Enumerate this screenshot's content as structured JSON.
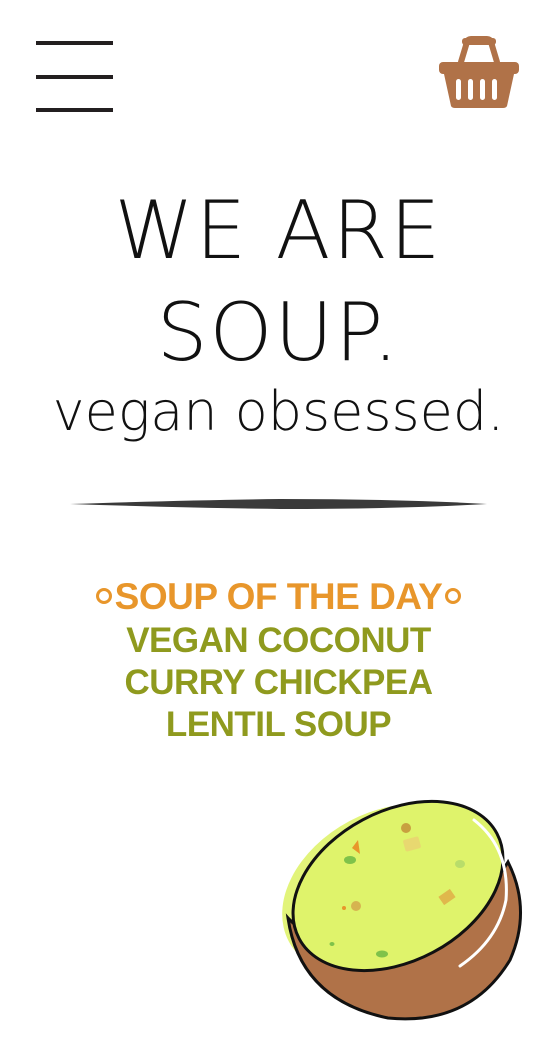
{
  "header": {
    "menu_icon": "hamburger-menu-icon",
    "cart_icon": "basket-icon"
  },
  "hero": {
    "title_line1": "WE ARE",
    "title_line2": "SOUP.",
    "tagline": "vegan obsessed."
  },
  "soup_of_the_day": {
    "heading": "SOUP OF THE DAY",
    "name_line1": "VEGAN COCONUT",
    "name_line2": "CURRY CHICKPEA",
    "name_line3": "LENTIL SOUP"
  },
  "illustration": {
    "icon": "soup-bowl-illustration"
  },
  "colors": {
    "heading_orange": "#e8962b",
    "name_olive": "#8f9a1e",
    "text_dark": "#111111",
    "basket_brown": "#b07248",
    "soup_green": "#dff36b",
    "bowl_brown": "#b07248"
  }
}
